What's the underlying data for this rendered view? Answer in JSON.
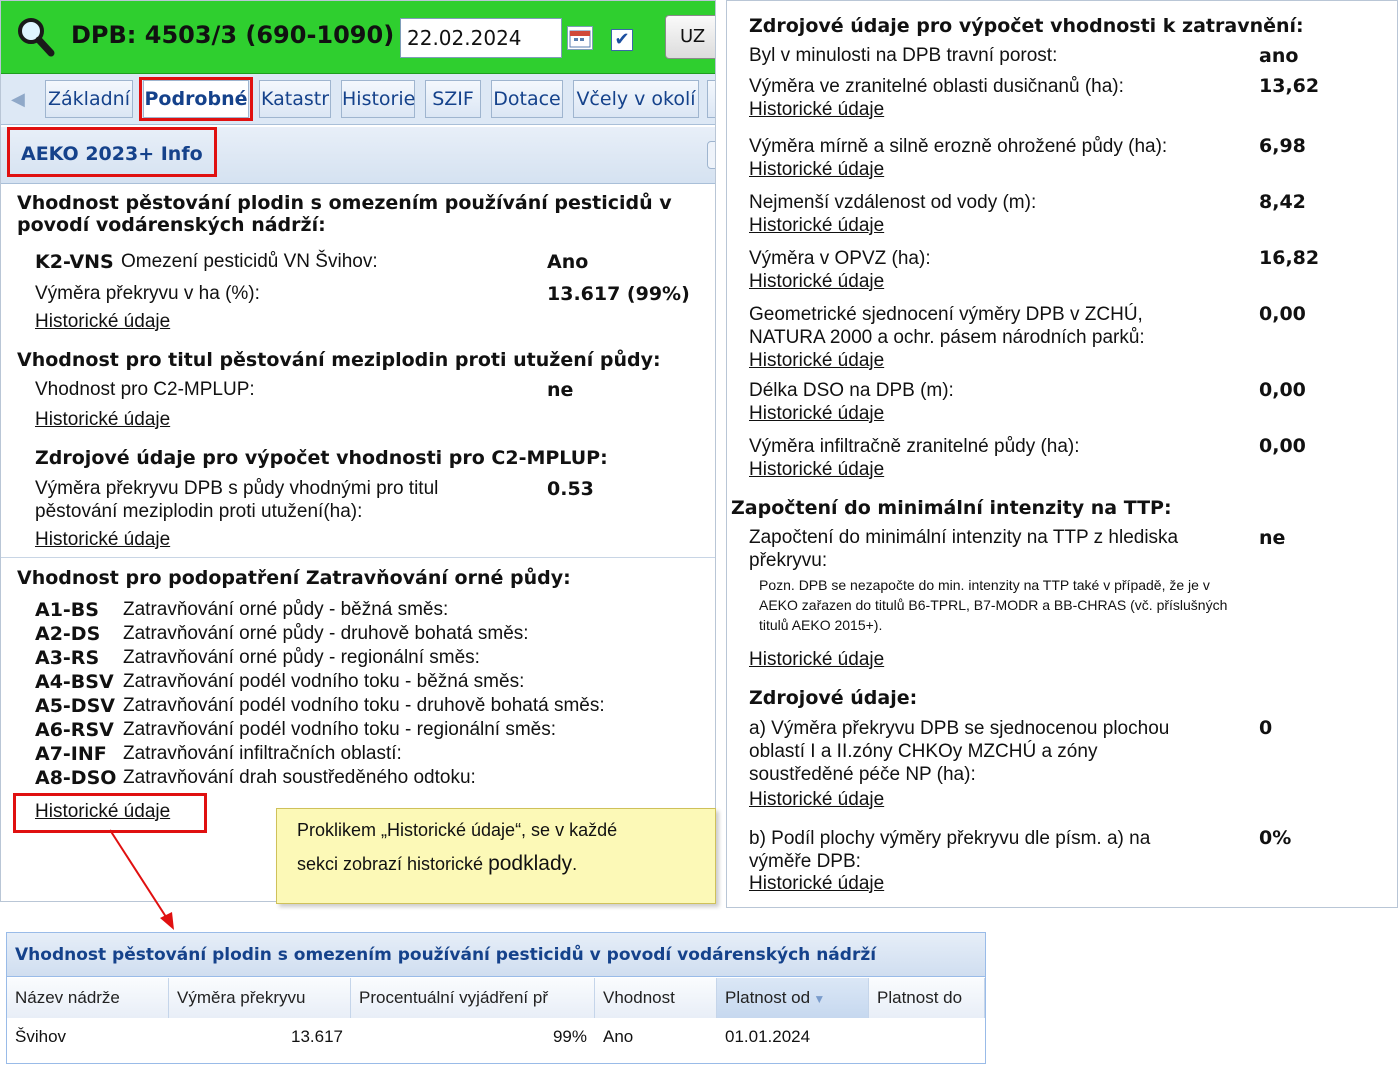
{
  "header": {
    "title": "DPB: 4503/3 (690-1090)",
    "date": "22.02.2024",
    "button_uz": "UZ",
    "checkbox_checked": true
  },
  "tabs": [
    {
      "label": "Základní"
    },
    {
      "label": "Podrobné"
    },
    {
      "label": "Katastr"
    },
    {
      "label": "Historie"
    },
    {
      "label": "SZIF"
    },
    {
      "label": "Dotace"
    },
    {
      "label": "Včely v okolí"
    }
  ],
  "section_title": "AEKO 2023+ Info",
  "historic_link": "Historické údaje",
  "left": {
    "pest": {
      "heading": "Vhodnost pěstování plodin s omezením používání pesticidů v povodí vodárenských nádrží:",
      "code": "K2-VNS",
      "code_text": "Omezení pesticidů VN Švihov:",
      "code_value": "Ano",
      "overlap_label": "Výměra překryvu v ha (%):",
      "overlap_value": "13.617 (99%)"
    },
    "mplup": {
      "heading": "Vhodnost pro titul pěstování meziplodin proti utužení půdy:",
      "label": "Vhodnost pro C2-MPLUP:",
      "value": "ne",
      "src_heading": "Zdrojové údaje pro výpočet vhodnosti pro C2-MPLUP:",
      "src_label_1": "Výměra překryvu DPB s půdy vhodnými pro titul",
      "src_label_2": "pěstování meziplodin proti utužení(ha):",
      "src_value": "0.53"
    },
    "grass": {
      "heading": "Vhodnost pro podopatření Zatravňování orné půdy:",
      "items": [
        {
          "code": "A1-BS",
          "text": "Zatravňování orné půdy - běžná směs:"
        },
        {
          "code": "A2-DS",
          "text": "Zatravňování orné půdy - druhově bohatá směs:"
        },
        {
          "code": "A3-RS",
          "text": "Zatravňování orné půdy - regionální směs:"
        },
        {
          "code": "A4-BSV",
          "text": "Zatravňování podél vodního toku - běžná směs:"
        },
        {
          "code": "A5-DSV",
          "text": "Zatravňování podél vodního toku - druhově bohatá směs:"
        },
        {
          "code": "A6-RSV",
          "text": "Zatravňování podél vodního toku - regionální směs:"
        },
        {
          "code": "A7-INF",
          "text": "Zatravňování infiltračních oblastí:"
        },
        {
          "code": "A8-DSO",
          "text": "Zatravňování drah soustředěného odtoku:"
        }
      ]
    }
  },
  "right": {
    "heading": "Zdrojové údaje pro výpočet vhodnosti k zatravnění:",
    "meadow_label": "Byl v minulosti na DPB travní porost:",
    "meadow_value": "ano",
    "rows": [
      {
        "label": "Výměra ve zranitelné oblasti dusičnanů (ha):",
        "value": "13,62"
      },
      {
        "label": "Výměra mírně a silně erozně ohrožené půdy (ha):",
        "value": "6,98"
      },
      {
        "label": "Nejmenší vzdálenost od vody (m):",
        "value": "8,42"
      },
      {
        "label": "Výměra v OPVZ (ha):",
        "value": "16,82"
      },
      {
        "label": "Geometrické sjednocení výměry DPB v ZCHÚ,",
        "label2": "NATURA 2000 a ochr. pásem národních parků:",
        "value": "0,00"
      },
      {
        "label": "Délka DSO na DPB (m):",
        "value": "0,00"
      },
      {
        "label": "Výměra infiltračně zranitelné půdy (ha):",
        "value": "0,00"
      }
    ],
    "ttp": {
      "heading": "Započtení do minimální intenzity na TTP:",
      "label": "Započtení do minimální intenzity na TTP z hlediska",
      "label2": "překryvu:",
      "value": "ne",
      "note1": "Pozn. DPB se nezapočte do min. intenzity na TTP také v případě, že je v",
      "note2": "AEKO zařazen do titulů B6-TPRL, B7-MODR a BB-CHRAS (vč. příslušných",
      "note3": "titulů AEKO 2015+)."
    },
    "src": {
      "heading": "Zdrojové údaje:",
      "a1": "a) Výměra překryvu DPB se sjednocenou plochou",
      "a2": "oblastí I a II.zóny CHKOy MZCHÚ a zóny",
      "a3": "soustředěné péče NP (ha):",
      "a_value": "0",
      "b1": "b) Podíl plochy výměry překryvu dle písm. a) na",
      "b2": "výměře DPB:",
      "b_value": "0%"
    }
  },
  "tooltip": {
    "line1": "Proklikem „Historické údaje“, se v každé",
    "line2a": "sekci zobrazí historické ",
    "line2b": "podklady",
    "line2c": "."
  },
  "grid": {
    "title": "Vhodnost pěstování plodin s omezením používání pesticidů v povodí vodárenských nádrží",
    "columns": [
      "Název nádrže",
      "Výměra překryvu",
      "Procentuální vyjádření př",
      "Vhodnost",
      "Platnost od",
      "Platnost do"
    ],
    "rows": [
      [
        "Švihov",
        "13.617",
        "99%",
        "Ano",
        "01.01.2024",
        ""
      ]
    ]
  },
  "colors": {
    "header_green": "#2fcf2f",
    "highlight_red": "#e01010",
    "tooltip_yellow": "#fcf9b7",
    "link_blue": "#15428b"
  }
}
